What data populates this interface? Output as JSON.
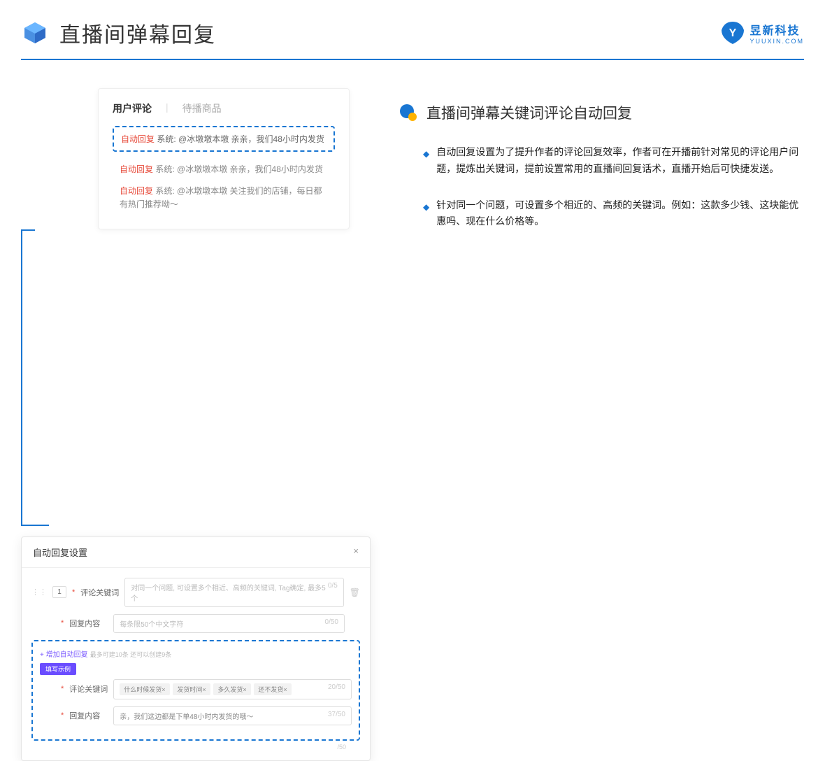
{
  "header": {
    "title": "直播间弹幕回复",
    "brand_name": "昱新科技",
    "brand_url": "YUUXIN.COM"
  },
  "comments": {
    "tab_active": "用户评论",
    "tab_inactive": "待播商品",
    "highlighted": {
      "tag": "自动回复",
      "text": "系统: @冰墩墩本墩 亲亲，我们48小时内发货"
    },
    "rows": [
      {
        "tag": "自动回复",
        "text": "系统: @冰墩墩本墩 亲亲，我们48小时内发货"
      },
      {
        "tag": "自动回复",
        "text": "系统: @冰墩墩本墩 关注我们的店铺，每日都有热门推荐呦～"
      }
    ]
  },
  "settings": {
    "title": "自动回复设置",
    "num": "1",
    "label_keyword": "评论关键词",
    "placeholder_keyword": "对同一个问题, 可设置多个相近、高频的关键词, Tag确定, 最多5个",
    "counter_keyword": "0/5",
    "label_content": "回复内容",
    "placeholder_content": "每条限50个中文字符",
    "counter_content": "0/50",
    "add_link": "+ 增加自动回复",
    "hint": "最多可建10条 还可以创建9条",
    "example_badge": "填写示例",
    "ex_label_keyword": "评论关键词",
    "ex_tags": [
      "什么时候发货×",
      "发货时间×",
      "多久发货×",
      "还不发货×"
    ],
    "ex_counter_kw": "20/50",
    "ex_label_content": "回复内容",
    "ex_content_text": "亲，我们这边都是下单48小时内发货的哦～",
    "ex_counter_ct": "37/50",
    "ex_counter_side": "/50"
  },
  "right": {
    "section_title": "直播间弹幕关键词评论自动回复",
    "bullets": [
      "自动回复设置为了提升作者的评论回复效率，作者可在开播前针对常见的评论用户问题，提炼出关键词，提前设置常用的直播间回复话术，直播开始后可快捷发送。",
      "针对同一个问题，可设置多个相近的、高频的关键词。例如：这款多少钱、这块能优惠吗、现在什么价格等。"
    ]
  }
}
